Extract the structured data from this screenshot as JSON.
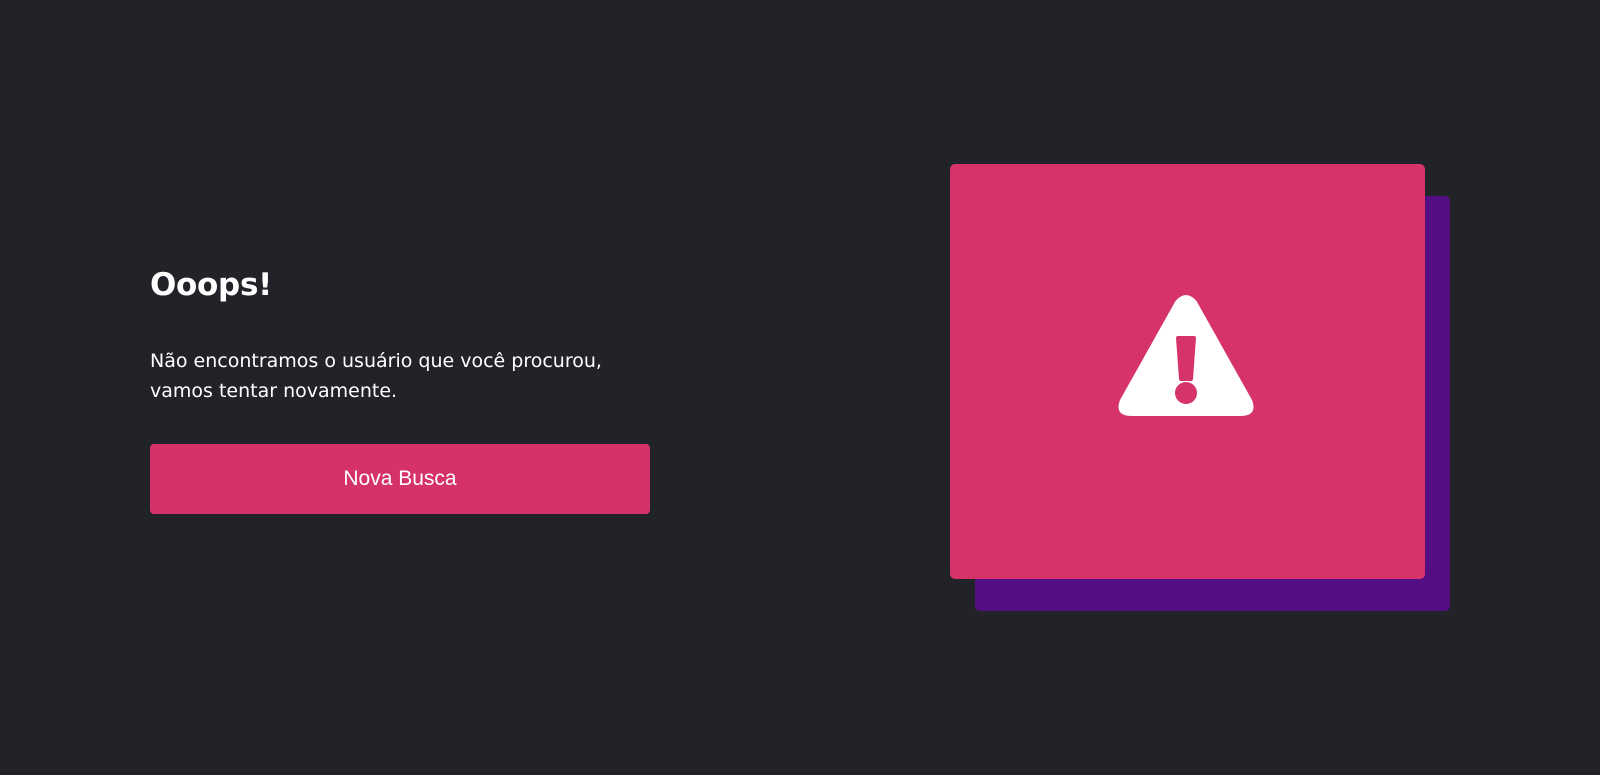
{
  "error": {
    "title": "Ooops!",
    "message": "Não encontramos o usuário que você procurou, vamos tentar novamente.",
    "button_label": "Nova Busca"
  },
  "illustration": {
    "icon": "warning-triangle-icon"
  },
  "colors": {
    "background": "#212328",
    "accent": "#d6326a",
    "shadow_card": "#530f82",
    "text": "#ffffff"
  }
}
